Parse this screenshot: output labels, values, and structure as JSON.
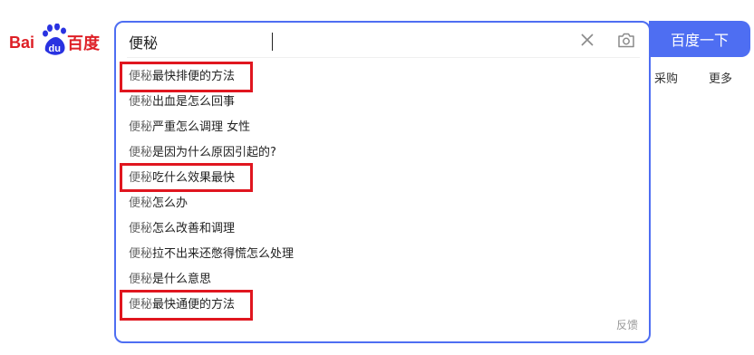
{
  "logo": {
    "text_bai": "Bai",
    "text_du": "du",
    "text_cn": "百度"
  },
  "search": {
    "value": "便秘",
    "clear_icon": "close-icon",
    "camera_icon": "camera-icon",
    "button_label": "百度一下"
  },
  "suggestions": [
    {
      "query": "便秘",
      "rest": "最快排便的方法",
      "highlighted": true
    },
    {
      "query": "便秘",
      "rest": "出血是怎么回事",
      "highlighted": false
    },
    {
      "query": "便秘",
      "rest": "严重怎么调理 女性",
      "highlighted": false
    },
    {
      "query": "便秘",
      "rest": "是因为什么原因引起的?",
      "highlighted": false
    },
    {
      "query": "便秘",
      "rest": "吃什么效果最快",
      "highlighted": true
    },
    {
      "query": "便秘",
      "rest": "怎么办",
      "highlighted": false
    },
    {
      "query": "便秘",
      "rest": "怎么改善和调理",
      "highlighted": false
    },
    {
      "query": "便秘",
      "rest": "拉不出来还憋得慌怎么处理",
      "highlighted": false
    },
    {
      "query": "便秘",
      "rest": "是什么意思",
      "highlighted": false
    },
    {
      "query": "便秘",
      "rest": "最快通便的方法",
      "highlighted": true
    }
  ],
  "feedback_label": "反馈",
  "right_links": {
    "purchase": "采购",
    "more": "更多"
  },
  "colors": {
    "brand_blue": "#4e6ef2",
    "baidu_red": "#de1f26",
    "highlight_red": "#e0161f"
  }
}
